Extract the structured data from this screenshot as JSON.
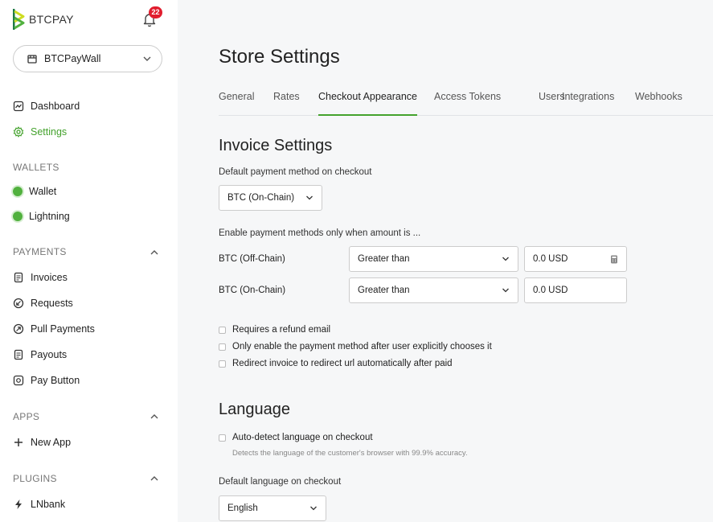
{
  "logo": {
    "text": "BTCPAY"
  },
  "notifications": {
    "count": "22"
  },
  "store": {
    "name": "BTCPayWall"
  },
  "nav": {
    "dashboard": "Dashboard",
    "settings": "Settings"
  },
  "wallets": {
    "title": "WALLETS",
    "items": [
      "Wallet",
      "Lightning"
    ]
  },
  "payments": {
    "title": "PAYMENTS",
    "items": [
      "Invoices",
      "Requests",
      "Pull Payments",
      "Payouts",
      "Pay Button"
    ]
  },
  "apps": {
    "title": "APPS",
    "new_app": "New App"
  },
  "plugins": {
    "title": "PLUGINS",
    "lnbank": "LNbank"
  },
  "page": {
    "title": "Store Settings"
  },
  "tabs": [
    "General",
    "Rates",
    "Checkout Appearance",
    "Access Tokens",
    "Users",
    "Integrations",
    "Webhooks"
  ],
  "invoice": {
    "heading": "Invoice Settings",
    "default_method_label": "Default payment method on checkout",
    "default_method_value": "BTC (On-Chain)",
    "enable_label": "Enable payment methods only when amount is ...",
    "rows": [
      {
        "label": "BTC (Off-Chain)",
        "condition": "Greater than",
        "amount": "0.0 USD"
      },
      {
        "label": "BTC (On-Chain)",
        "condition": "Greater than",
        "amount": "0.0 USD"
      }
    ],
    "checks": [
      "Requires a refund email",
      "Only enable the payment method after user explicitly chooses it",
      "Redirect invoice to redirect url automatically after paid"
    ]
  },
  "language": {
    "heading": "Language",
    "autodetect": "Auto-detect language on checkout",
    "autodetect_help": "Detects the language of the customer's browser with 99.9% accuracy.",
    "default_label": "Default language on checkout",
    "default_value": "English"
  },
  "colors": {
    "accent": "#44a22d",
    "badge": "#e11d2e"
  }
}
